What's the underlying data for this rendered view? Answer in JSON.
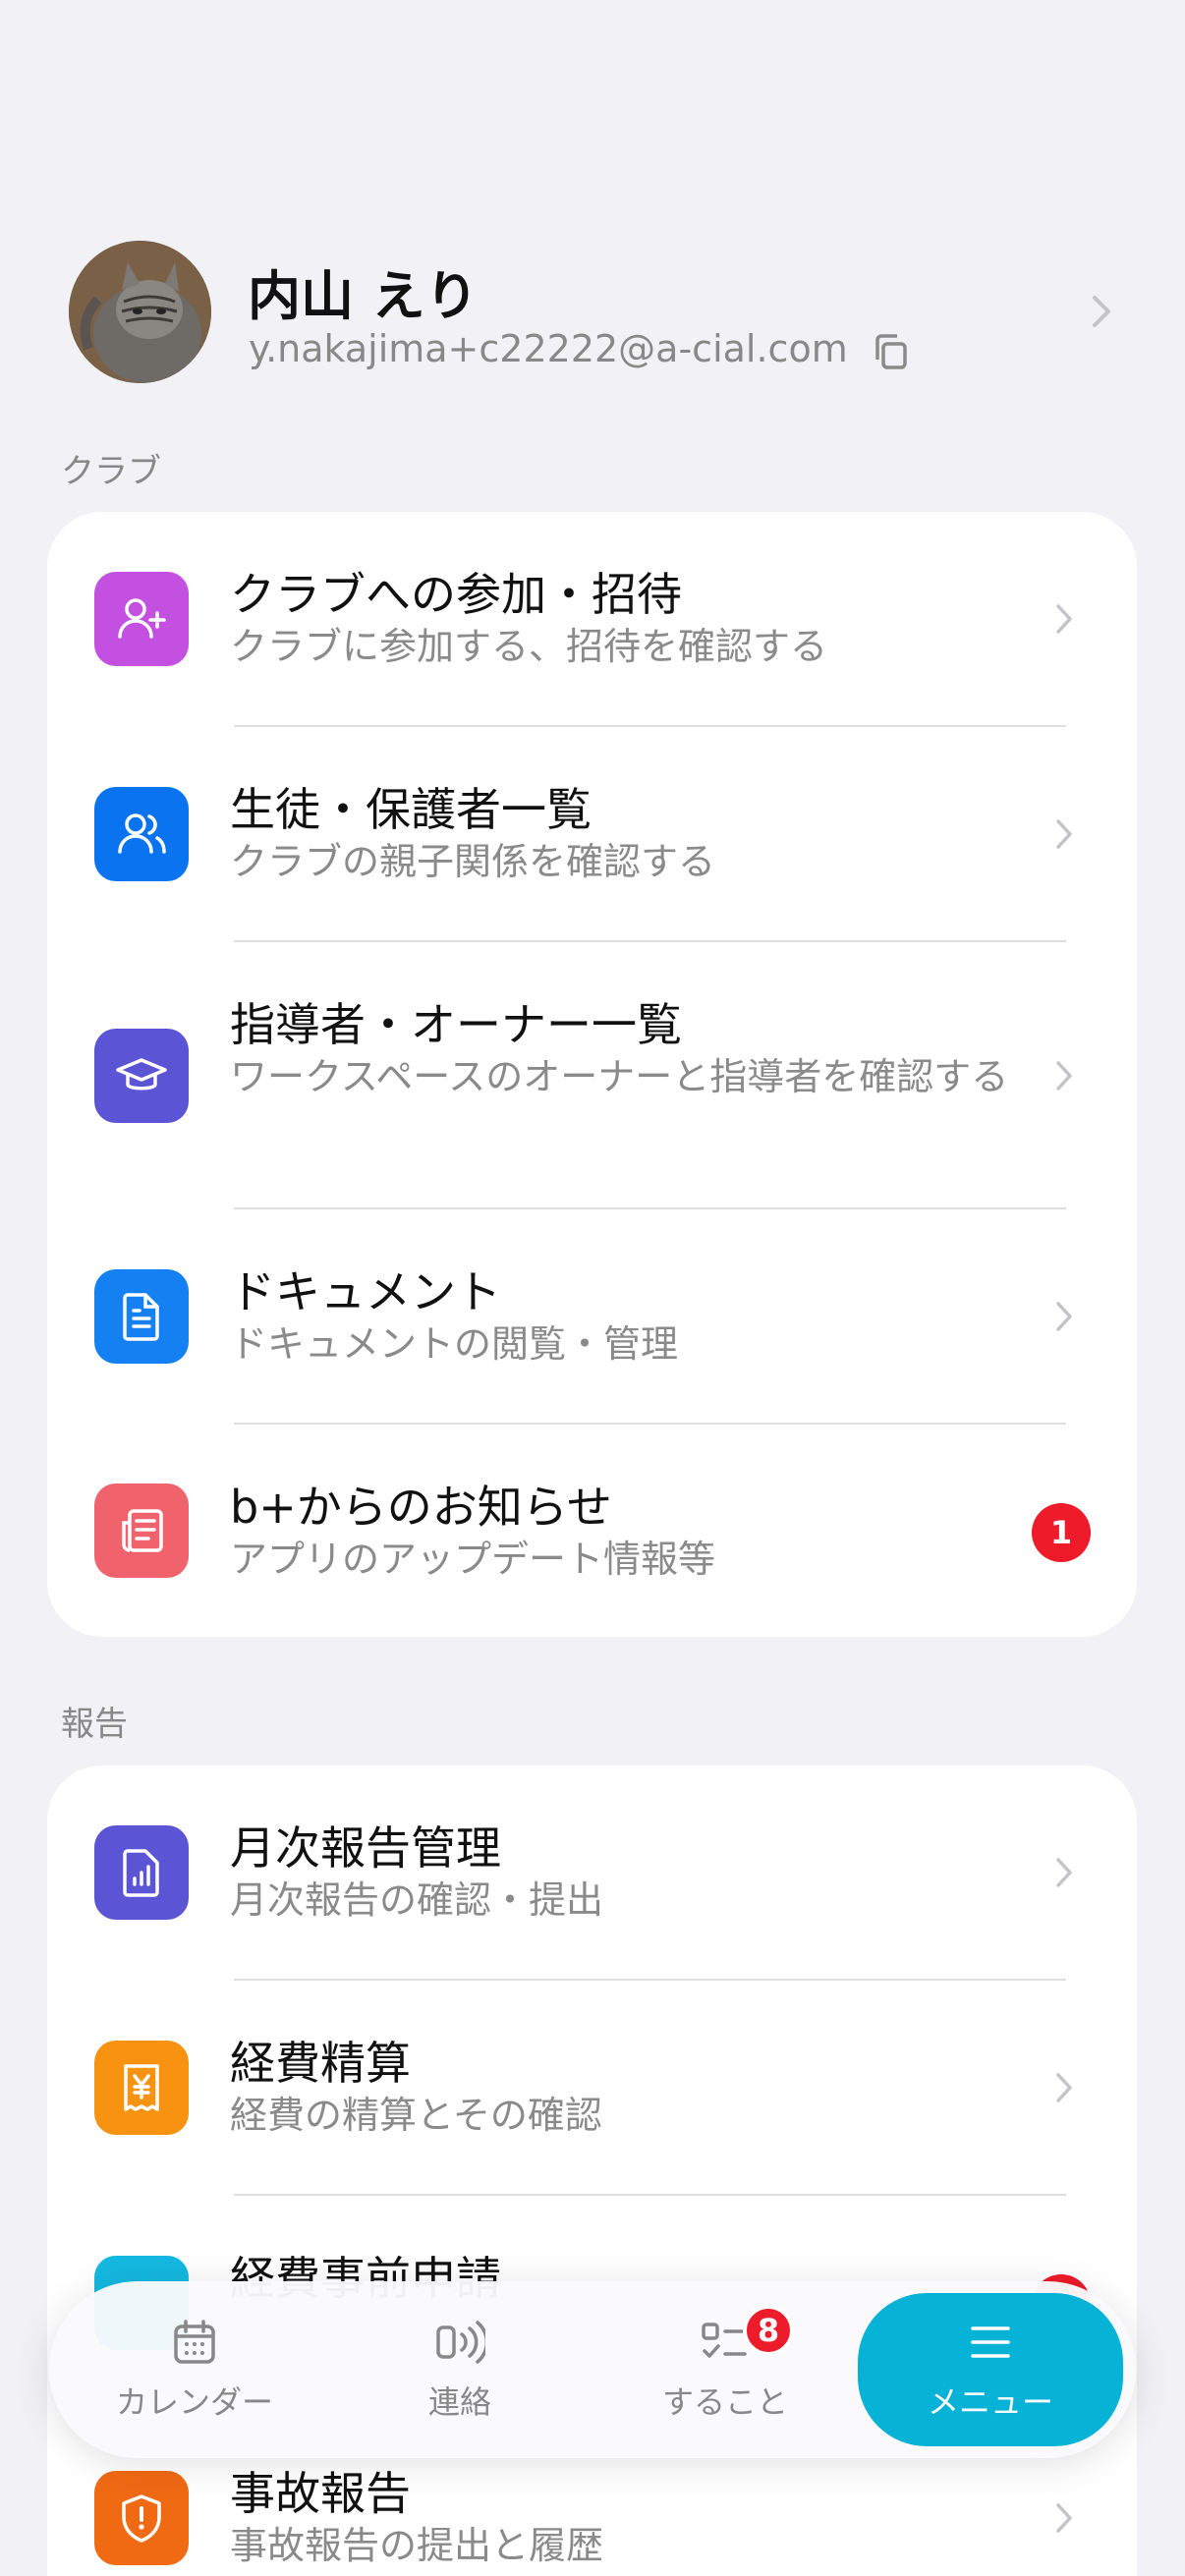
{
  "profile": {
    "name": "内山 えり",
    "email": "y.nakajima+c22222@a-cial.com"
  },
  "sections": {
    "club_label": "クラブ",
    "report_label": "報告"
  },
  "club_items": [
    {
      "title": "クラブへの参加・招待",
      "subtitle": "クラブに参加する、招待を確認する",
      "icon": "user-plus-icon",
      "color": "#c350e0"
    },
    {
      "title": "生徒・保護者一覧",
      "subtitle": "クラブの親子関係を確認する",
      "icon": "users-icon",
      "color": "#0a74f0"
    },
    {
      "title": "指導者・オーナー一覧",
      "subtitle": "ワークスペースのオーナーと指導者を確認する",
      "icon": "graduation-cap-icon",
      "color": "#5b55d6"
    },
    {
      "title": "ドキュメント",
      "subtitle": "ドキュメントの閲覧・管理",
      "icon": "document-icon",
      "color": "#1480f2"
    },
    {
      "title": "b+からのお知らせ",
      "subtitle": "アプリのアップデート情報等",
      "icon": "newspaper-icon",
      "color": "#f0636c",
      "badge": "1"
    }
  ],
  "report_items": [
    {
      "title": "月次報告管理",
      "subtitle": "月次報告の確認・提出",
      "icon": "report-chart-icon",
      "color": "#5b55d6"
    },
    {
      "title": "経費精算",
      "subtitle": "経費の精算とその確認",
      "icon": "receipt-yen-icon",
      "color": "#f79311"
    },
    {
      "title": "経費事前申請",
      "subtitle": "",
      "icon": "calendar-icon",
      "color": "#14b8e0"
    },
    {
      "title": "事故報告",
      "subtitle": "事故報告の提出と履歴",
      "icon": "shield-alert-icon",
      "color": "#f06a14"
    }
  ],
  "tabbar": {
    "tabs": [
      {
        "label": "カレンダー",
        "icon": "calendar-icon"
      },
      {
        "label": "連絡",
        "icon": "broadcast-icon"
      },
      {
        "label": "すること",
        "icon": "checklist-icon",
        "badge": "8"
      },
      {
        "label": "メニュー",
        "icon": "menu-icon",
        "active": true
      }
    ]
  },
  "colors": {
    "accent": "#06b2d6",
    "badge": "#ee1b2a",
    "background": "#f2f2f6"
  }
}
